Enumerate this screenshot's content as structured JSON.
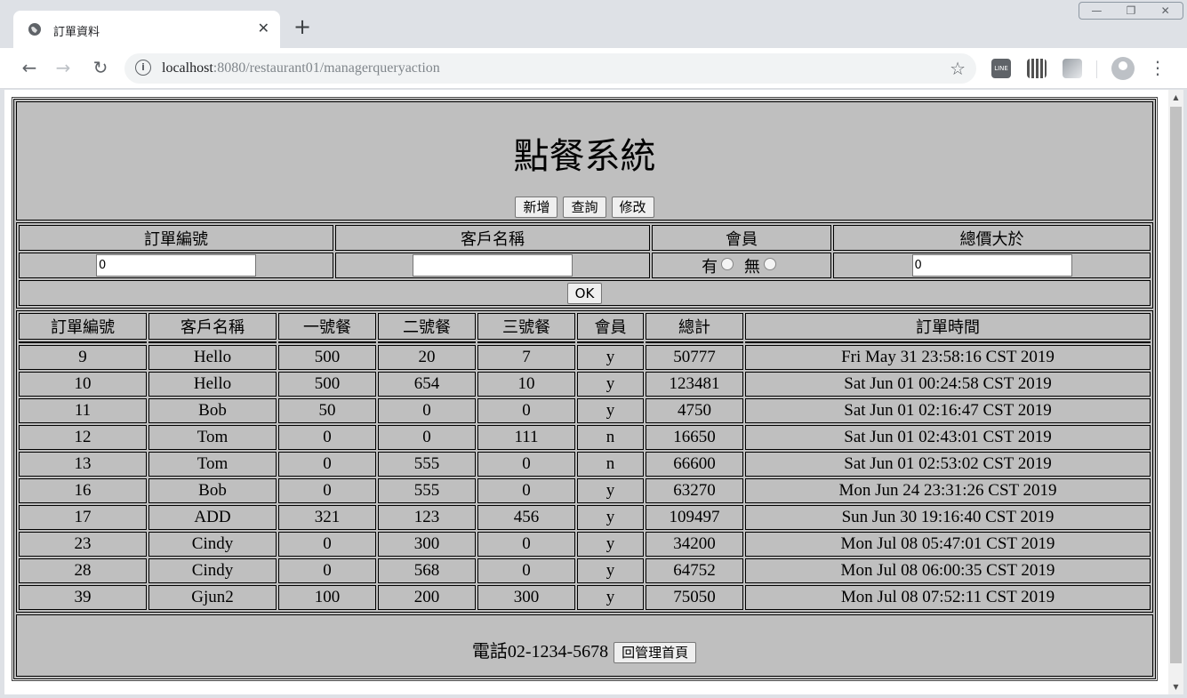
{
  "browser": {
    "tab_title": "訂單資料",
    "tab_close": "✕",
    "new_tab": "+",
    "url_host": "localhost",
    "url_path": ":8080/restaurant01/managerqueryaction",
    "window_controls": [
      "—",
      "❐",
      "✕"
    ]
  },
  "page": {
    "title": "點餐系統",
    "nav_buttons": {
      "add": "新增",
      "query": "查詢",
      "modify": "修改"
    }
  },
  "query_form": {
    "headers": [
      "訂單編號",
      "客戶名稱",
      "會員",
      "總價大於"
    ],
    "order_id_value": "0",
    "customer_value": "",
    "member_yes_label": "有",
    "member_no_label": "無",
    "total_min_value": "0",
    "ok_label": "OK"
  },
  "orders": {
    "columns": [
      "訂單編號",
      "客戶名稱",
      "一號餐",
      "二號餐",
      "三號餐",
      "會員",
      "總計",
      "訂單時間"
    ],
    "rows": [
      [
        "9",
        "Hello",
        "500",
        "20",
        "7",
        "y",
        "50777",
        "Fri May 31 23:58:16 CST 2019"
      ],
      [
        "10",
        "Hello",
        "500",
        "654",
        "10",
        "y",
        "123481",
        "Sat Jun 01 00:24:58 CST 2019"
      ],
      [
        "11",
        "Bob",
        "50",
        "0",
        "0",
        "y",
        "4750",
        "Sat Jun 01 02:16:47 CST 2019"
      ],
      [
        "12",
        "Tom",
        "0",
        "0",
        "111",
        "n",
        "16650",
        "Sat Jun 01 02:43:01 CST 2019"
      ],
      [
        "13",
        "Tom",
        "0",
        "555",
        "0",
        "n",
        "66600",
        "Sat Jun 01 02:53:02 CST 2019"
      ],
      [
        "16",
        "Bob",
        "0",
        "555",
        "0",
        "y",
        "63270",
        "Mon Jun 24 23:31:26 CST 2019"
      ],
      [
        "17",
        "ADD",
        "321",
        "123",
        "456",
        "y",
        "109497",
        "Sun Jun 30 19:16:40 CST 2019"
      ],
      [
        "23",
        "Cindy",
        "0",
        "300",
        "0",
        "y",
        "34200",
        "Mon Jul 08 05:47:01 CST 2019"
      ],
      [
        "28",
        "Cindy",
        "0",
        "568",
        "0",
        "y",
        "64752",
        "Mon Jul 08 06:00:35 CST 2019"
      ],
      [
        "39",
        "Gjun2",
        "100",
        "200",
        "300",
        "y",
        "75050",
        "Mon Jul 08 07:52:11 CST 2019"
      ]
    ]
  },
  "footer": {
    "phone": "電話02-1234-5678",
    "home_button": "回管理首頁"
  }
}
